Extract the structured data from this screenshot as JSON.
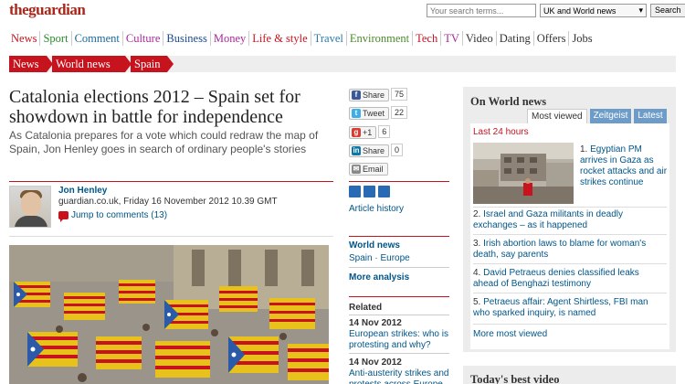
{
  "brand": {
    "the": "the",
    "name": "guardian"
  },
  "search": {
    "placeholder": "Your search terms...",
    "edition": "UK and World news",
    "button": "Search"
  },
  "nav": [
    {
      "label": "News",
      "color": "#c7131e"
    },
    {
      "label": "Sport",
      "color": "#2a8a2a"
    },
    {
      "label": "Comment",
      "color": "#1a6a9a"
    },
    {
      "label": "Culture",
      "color": "#a7299c"
    },
    {
      "label": "Business",
      "color": "#1a4a8a"
    },
    {
      "label": "Money",
      "color": "#a7299c"
    },
    {
      "label": "Life & style",
      "color": "#c7131e"
    },
    {
      "label": "Travel",
      "color": "#2a7aaa"
    },
    {
      "label": "Environment",
      "color": "#4a8a2a"
    },
    {
      "label": "Tech",
      "color": "#c7131e"
    },
    {
      "label": "TV",
      "color": "#a7299c"
    },
    {
      "label": "Video",
      "color": "#333333"
    },
    {
      "label": "Dating",
      "color": "#333333"
    },
    {
      "label": "Offers",
      "color": "#333333"
    },
    {
      "label": "Jobs",
      "color": "#333333"
    }
  ],
  "breadcrumb": [
    "News",
    "World news",
    "Spain"
  ],
  "article": {
    "headline": "Catalonia elections 2012 – Spain set for showdown in battle for independence",
    "standfirst": "As Catalonia prepares for a vote which could redraw the map of Spain, Jon Henley goes in search of ordinary people's stories",
    "author": "Jon Henley",
    "meta": "guardian.co.uk, Friday 16 November 2012 10.39 GMT",
    "comments": "Jump to comments (13)"
  },
  "share": {
    "facebook": {
      "label": "Share",
      "count": "75"
    },
    "twitter": {
      "label": "Tweet",
      "count": "22"
    },
    "gplus": {
      "label": "+1",
      "count": "6"
    },
    "linkedin": {
      "label": "Share",
      "count": "0"
    },
    "email": {
      "label": "Email"
    }
  },
  "sidebar_mid": {
    "article_history": "Article history",
    "section": "World news",
    "tags": "Spain · Europe",
    "more_analysis": "More analysis",
    "related_heading": "Related",
    "related": [
      {
        "date": "14 Nov 2012",
        "title": "European strikes: who is protesting and why?"
      },
      {
        "date": "14 Nov 2012",
        "title": "Anti-austerity strikes and protests across Europe"
      }
    ]
  },
  "most_viewed": {
    "heading": "On World news",
    "tabs": [
      "Most viewed",
      "Zeitgeist",
      "Latest"
    ],
    "period": "Last 24 hours",
    "items": [
      {
        "n": "1.",
        "title": "Egyptian PM arrives in Gaza as rocket attacks and air strikes continue"
      },
      {
        "n": "2.",
        "title": "Israel and Gaza militants in deadly exchanges – as it happened"
      },
      {
        "n": "3.",
        "title": "Irish abortion laws to blame for woman's death, say parents"
      },
      {
        "n": "4.",
        "title": "David Petraeus denies classified leaks ahead of Benghazi testimony"
      },
      {
        "n": "5.",
        "title": "Petraeus affair: Agent Shirtless, FBI man who sparked inquiry, is named"
      }
    ],
    "more": "More most viewed"
  },
  "best_video": "Today's best video"
}
